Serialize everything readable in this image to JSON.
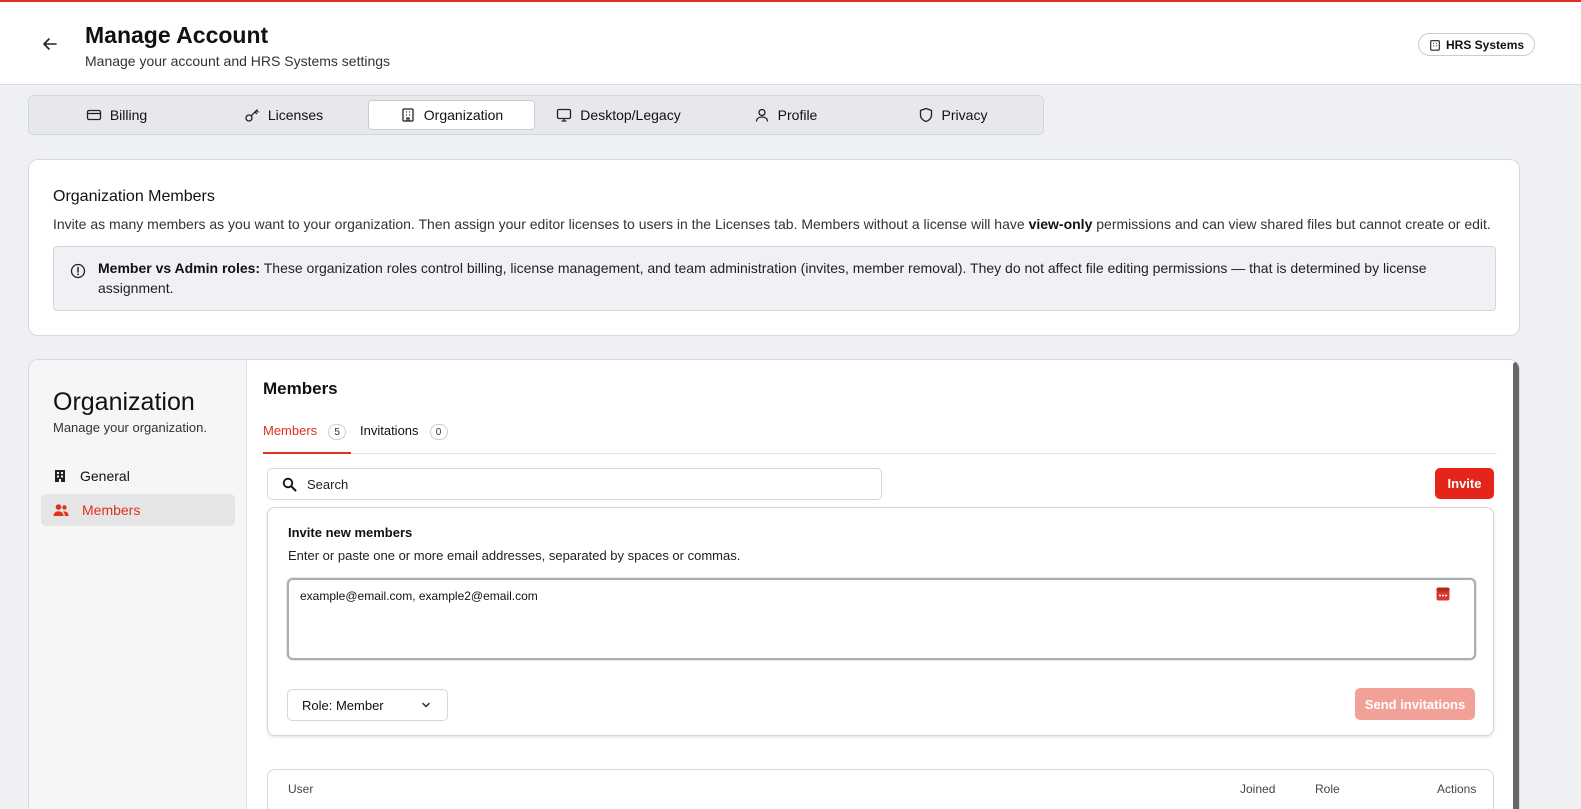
{
  "header": {
    "title": "Manage Account",
    "subtitle": "Manage your account and HRS Systems settings",
    "org_chip": "HRS Systems"
  },
  "tabs": [
    {
      "label": "Billing",
      "icon": "credit-card-icon"
    },
    {
      "label": "Licenses",
      "icon": "key-icon"
    },
    {
      "label": "Organization",
      "icon": "building-icon",
      "active": true
    },
    {
      "label": "Desktop/Legacy",
      "icon": "monitor-icon"
    },
    {
      "label": "Profile",
      "icon": "user-icon"
    },
    {
      "label": "Privacy",
      "icon": "shield-icon"
    }
  ],
  "org_members_card": {
    "title": "Organization Members",
    "desc_before": "Invite as many members as you want to your organization. Then assign your editor licenses to users in the Licenses tab. Members without a license will have ",
    "desc_bold": "view-only",
    "desc_after": " permissions and can view shared files but cannot create or edit.",
    "notice_bold": "Member vs Admin roles:",
    "notice_text": " These organization roles control billing, license management, and team administration (invites, member removal). They do not affect file editing permissions — that is determined by license assignment."
  },
  "sidebar": {
    "title": "Organization",
    "subtitle": "Manage your organization.",
    "items": [
      {
        "label": "General",
        "icon": "building-icon"
      },
      {
        "label": "Members",
        "icon": "users-icon",
        "active": true
      }
    ]
  },
  "members": {
    "title": "Members",
    "subtabs": [
      {
        "label": "Members",
        "count": "5",
        "active": true
      },
      {
        "label": "Invitations",
        "count": "0"
      }
    ],
    "search_placeholder": "Search",
    "invite_button": "Invite",
    "invite_panel": {
      "title": "Invite new members",
      "description": "Enter or paste one or more email addresses, separated by spaces or commas.",
      "emails": "example@email.com, example2@email.com",
      "role_select": "Role: Member",
      "send_button": "Send invitations"
    },
    "table_headers": {
      "user": "User",
      "joined": "Joined",
      "role": "Role",
      "actions": "Actions"
    }
  },
  "colors": {
    "accent": "#e5241a",
    "accent_disabled": "#f2a199"
  }
}
